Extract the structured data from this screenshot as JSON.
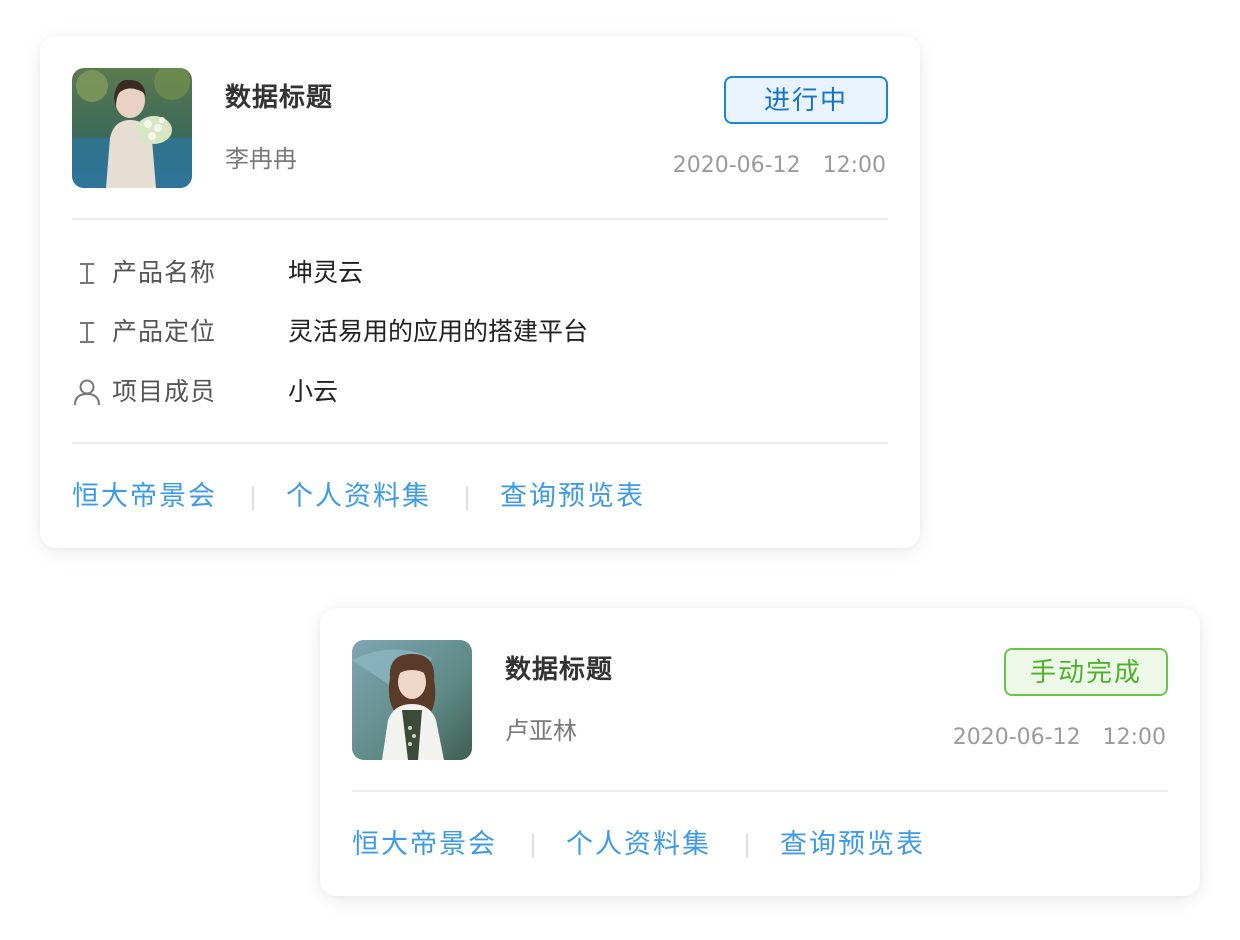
{
  "cards": [
    {
      "title": "数据标题",
      "author": "李冉冉",
      "status": "进行中",
      "status_color": "#1674c8",
      "date": "2020-06-12",
      "time": "12:00",
      "fields": [
        {
          "icon": "text-type-icon",
          "label": "产品名称",
          "value": "坤灵云"
        },
        {
          "icon": "text-type-icon",
          "label": "产品定位",
          "value": "灵活易用的应用的搭建平台"
        },
        {
          "icon": "user-icon",
          "label": "项目成员",
          "value": "小云"
        }
      ],
      "actions": [
        "恒大帝景会",
        "个人资料集",
        "查询预览表"
      ]
    },
    {
      "title": "数据标题",
      "author": "卢亚林",
      "status": "手动完成",
      "status_color": "#4fb02c",
      "date": "2020-06-12",
      "time": "12:00",
      "actions": [
        "恒大帝景会",
        "个人资料集",
        "查询预览表"
      ]
    }
  ],
  "colors": {
    "link": "#3d9be6",
    "status_in_progress_border": "#1d84d6",
    "status_done_border": "#6cc449"
  }
}
